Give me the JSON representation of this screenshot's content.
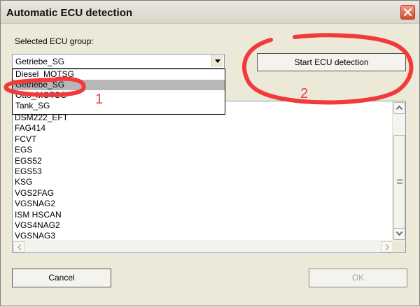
{
  "window": {
    "title": "Automatic ECU detection",
    "close_icon": "close-icon"
  },
  "group": {
    "label": "Selected ECU group:",
    "selected": "Getriebe_SG",
    "options": [
      "Diesel_MOTSG",
      "Getriebe_SG",
      "Otto_MOTSG",
      "Tank_SG"
    ],
    "highlighted_index": 1
  },
  "start_button": "Start ECU detection",
  "ecu_list": [
    "DSM222_EFT",
    "FAG414",
    "FCVT",
    "EGS",
    "EGS52",
    "EGS53",
    "KSG",
    "VGS2FAG",
    "VGSNAG2",
    "ISM HSCAN",
    "VGS4NAG2",
    "VGSNAG3"
  ],
  "buttons": {
    "cancel": "Cancel",
    "ok": "OK"
  },
  "annotations": {
    "marker_1": "1",
    "marker_2": "2",
    "color": "#f23a3a"
  }
}
